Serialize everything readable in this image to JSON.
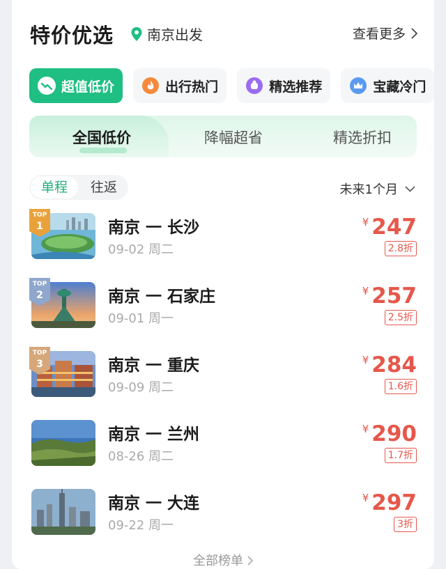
{
  "header": {
    "title": "特价优选",
    "origin": "南京出发",
    "more": "查看更多"
  },
  "chips": [
    {
      "label": "超值低价",
      "icon": "trend-down-icon",
      "active": true
    },
    {
      "label": "出行热门",
      "icon": "flame-icon",
      "active": false
    },
    {
      "label": "精选推荐",
      "icon": "thumb-icon",
      "active": false
    },
    {
      "label": "宝藏冷门",
      "icon": "crown-icon",
      "active": false
    }
  ],
  "segments": {
    "tab1": "全国低价",
    "tab2": "降幅超省",
    "tab3": "精选折扣"
  },
  "trip": {
    "oneway": "单程",
    "roundtrip": "往返",
    "range": "未来1个月"
  },
  "badge_top": "TOP",
  "currency": "¥",
  "flights": [
    {
      "rank": "1",
      "route": "南京 一 长沙",
      "date": "09-02 周二",
      "price": "247",
      "discount": "2.8折"
    },
    {
      "rank": "2",
      "route": "南京 一 石家庄",
      "date": "09-01 周一",
      "price": "257",
      "discount": "2.5折"
    },
    {
      "rank": "3",
      "route": "南京 一 重庆",
      "date": "09-09 周二",
      "price": "284",
      "discount": "1.6折"
    },
    {
      "rank": "",
      "route": "南京 一 兰州",
      "date": "08-26 周二",
      "price": "290",
      "discount": "1.7折"
    },
    {
      "rank": "",
      "route": "南京 一 大连",
      "date": "09-22 周一",
      "price": "297",
      "discount": "3折"
    }
  ],
  "footer": "全部榜单",
  "colors": {
    "accent": "#1fbf83",
    "price": "#e6574b",
    "badge_gold": "#e9a23b",
    "badge_silver": "#8fa7cc",
    "badge_bronze": "#d6a77a"
  }
}
